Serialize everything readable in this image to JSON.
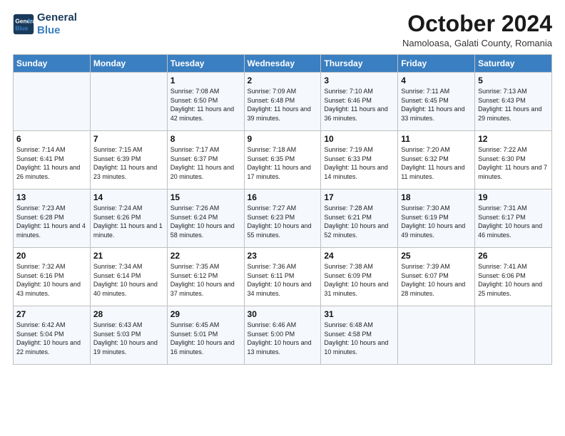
{
  "logo": {
    "line1": "General",
    "line2": "Blue"
  },
  "title": "October 2024",
  "subtitle": "Namoloasa, Galati County, Romania",
  "days_of_week": [
    "Sunday",
    "Monday",
    "Tuesday",
    "Wednesday",
    "Thursday",
    "Friday",
    "Saturday"
  ],
  "weeks": [
    [
      {
        "day": "",
        "content": ""
      },
      {
        "day": "",
        "content": ""
      },
      {
        "day": "1",
        "content": "Sunrise: 7:08 AM\nSunset: 6:50 PM\nDaylight: 11 hours and 42 minutes."
      },
      {
        "day": "2",
        "content": "Sunrise: 7:09 AM\nSunset: 6:48 PM\nDaylight: 11 hours and 39 minutes."
      },
      {
        "day": "3",
        "content": "Sunrise: 7:10 AM\nSunset: 6:46 PM\nDaylight: 11 hours and 36 minutes."
      },
      {
        "day": "4",
        "content": "Sunrise: 7:11 AM\nSunset: 6:45 PM\nDaylight: 11 hours and 33 minutes."
      },
      {
        "day": "5",
        "content": "Sunrise: 7:13 AM\nSunset: 6:43 PM\nDaylight: 11 hours and 29 minutes."
      }
    ],
    [
      {
        "day": "6",
        "content": "Sunrise: 7:14 AM\nSunset: 6:41 PM\nDaylight: 11 hours and 26 minutes."
      },
      {
        "day": "7",
        "content": "Sunrise: 7:15 AM\nSunset: 6:39 PM\nDaylight: 11 hours and 23 minutes."
      },
      {
        "day": "8",
        "content": "Sunrise: 7:17 AM\nSunset: 6:37 PM\nDaylight: 11 hours and 20 minutes."
      },
      {
        "day": "9",
        "content": "Sunrise: 7:18 AM\nSunset: 6:35 PM\nDaylight: 11 hours and 17 minutes."
      },
      {
        "day": "10",
        "content": "Sunrise: 7:19 AM\nSunset: 6:33 PM\nDaylight: 11 hours and 14 minutes."
      },
      {
        "day": "11",
        "content": "Sunrise: 7:20 AM\nSunset: 6:32 PM\nDaylight: 11 hours and 11 minutes."
      },
      {
        "day": "12",
        "content": "Sunrise: 7:22 AM\nSunset: 6:30 PM\nDaylight: 11 hours and 7 minutes."
      }
    ],
    [
      {
        "day": "13",
        "content": "Sunrise: 7:23 AM\nSunset: 6:28 PM\nDaylight: 11 hours and 4 minutes."
      },
      {
        "day": "14",
        "content": "Sunrise: 7:24 AM\nSunset: 6:26 PM\nDaylight: 11 hours and 1 minute."
      },
      {
        "day": "15",
        "content": "Sunrise: 7:26 AM\nSunset: 6:24 PM\nDaylight: 10 hours and 58 minutes."
      },
      {
        "day": "16",
        "content": "Sunrise: 7:27 AM\nSunset: 6:23 PM\nDaylight: 10 hours and 55 minutes."
      },
      {
        "day": "17",
        "content": "Sunrise: 7:28 AM\nSunset: 6:21 PM\nDaylight: 10 hours and 52 minutes."
      },
      {
        "day": "18",
        "content": "Sunrise: 7:30 AM\nSunset: 6:19 PM\nDaylight: 10 hours and 49 minutes."
      },
      {
        "day": "19",
        "content": "Sunrise: 7:31 AM\nSunset: 6:17 PM\nDaylight: 10 hours and 46 minutes."
      }
    ],
    [
      {
        "day": "20",
        "content": "Sunrise: 7:32 AM\nSunset: 6:16 PM\nDaylight: 10 hours and 43 minutes."
      },
      {
        "day": "21",
        "content": "Sunrise: 7:34 AM\nSunset: 6:14 PM\nDaylight: 10 hours and 40 minutes."
      },
      {
        "day": "22",
        "content": "Sunrise: 7:35 AM\nSunset: 6:12 PM\nDaylight: 10 hours and 37 minutes."
      },
      {
        "day": "23",
        "content": "Sunrise: 7:36 AM\nSunset: 6:11 PM\nDaylight: 10 hours and 34 minutes."
      },
      {
        "day": "24",
        "content": "Sunrise: 7:38 AM\nSunset: 6:09 PM\nDaylight: 10 hours and 31 minutes."
      },
      {
        "day": "25",
        "content": "Sunrise: 7:39 AM\nSunset: 6:07 PM\nDaylight: 10 hours and 28 minutes."
      },
      {
        "day": "26",
        "content": "Sunrise: 7:41 AM\nSunset: 6:06 PM\nDaylight: 10 hours and 25 minutes."
      }
    ],
    [
      {
        "day": "27",
        "content": "Sunrise: 6:42 AM\nSunset: 5:04 PM\nDaylight: 10 hours and 22 minutes."
      },
      {
        "day": "28",
        "content": "Sunrise: 6:43 AM\nSunset: 5:03 PM\nDaylight: 10 hours and 19 minutes."
      },
      {
        "day": "29",
        "content": "Sunrise: 6:45 AM\nSunset: 5:01 PM\nDaylight: 10 hours and 16 minutes."
      },
      {
        "day": "30",
        "content": "Sunrise: 6:46 AM\nSunset: 5:00 PM\nDaylight: 10 hours and 13 minutes."
      },
      {
        "day": "31",
        "content": "Sunrise: 6:48 AM\nSunset: 4:58 PM\nDaylight: 10 hours and 10 minutes."
      },
      {
        "day": "",
        "content": ""
      },
      {
        "day": "",
        "content": ""
      }
    ]
  ]
}
